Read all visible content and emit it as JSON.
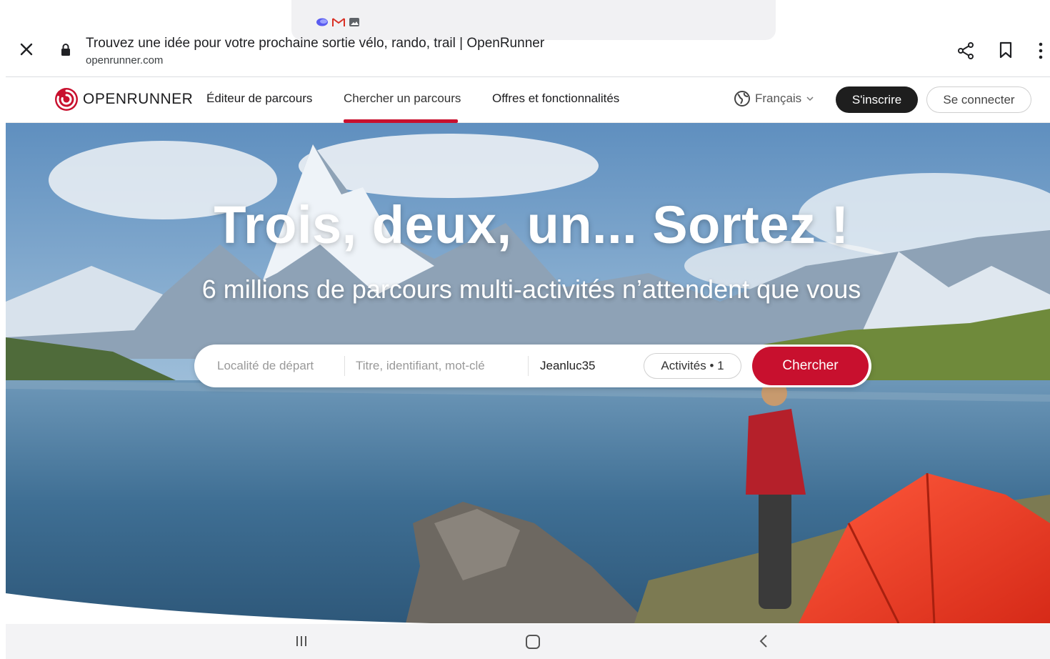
{
  "status_bar": {
    "icons": [
      "assistant-icon",
      "gmail-icon",
      "gallery-icon"
    ]
  },
  "custom_tab": {
    "title": "Trouvez une idée pour votre prochaine sortie vélo, rando, trail | OpenRunner",
    "url": "openrunner.com"
  },
  "site_nav": {
    "logo_text": "OPENRUNNER",
    "links": {
      "editor": "Éditeur de parcours",
      "search": "Chercher un parcours",
      "offers": "Offres et fonctionnalités"
    },
    "active_link": "search",
    "language": "Français",
    "signup_label": "S'inscrire",
    "login_label": "Se connecter"
  },
  "hero": {
    "title": "Trois, deux, un... Sortez !",
    "subtitle": "6 millions de parcours multi-activités n’attendent que vous"
  },
  "search": {
    "locality_placeholder": "Localité de départ",
    "keyword_placeholder": "Titre, identifiant, mot-clé",
    "user_value": "Jeanluc35",
    "activities_label": "Activités • 1",
    "submit_label": "Chercher"
  },
  "colors": {
    "brand_red": "#c8102e",
    "dark_button": "#1e1e1e"
  }
}
